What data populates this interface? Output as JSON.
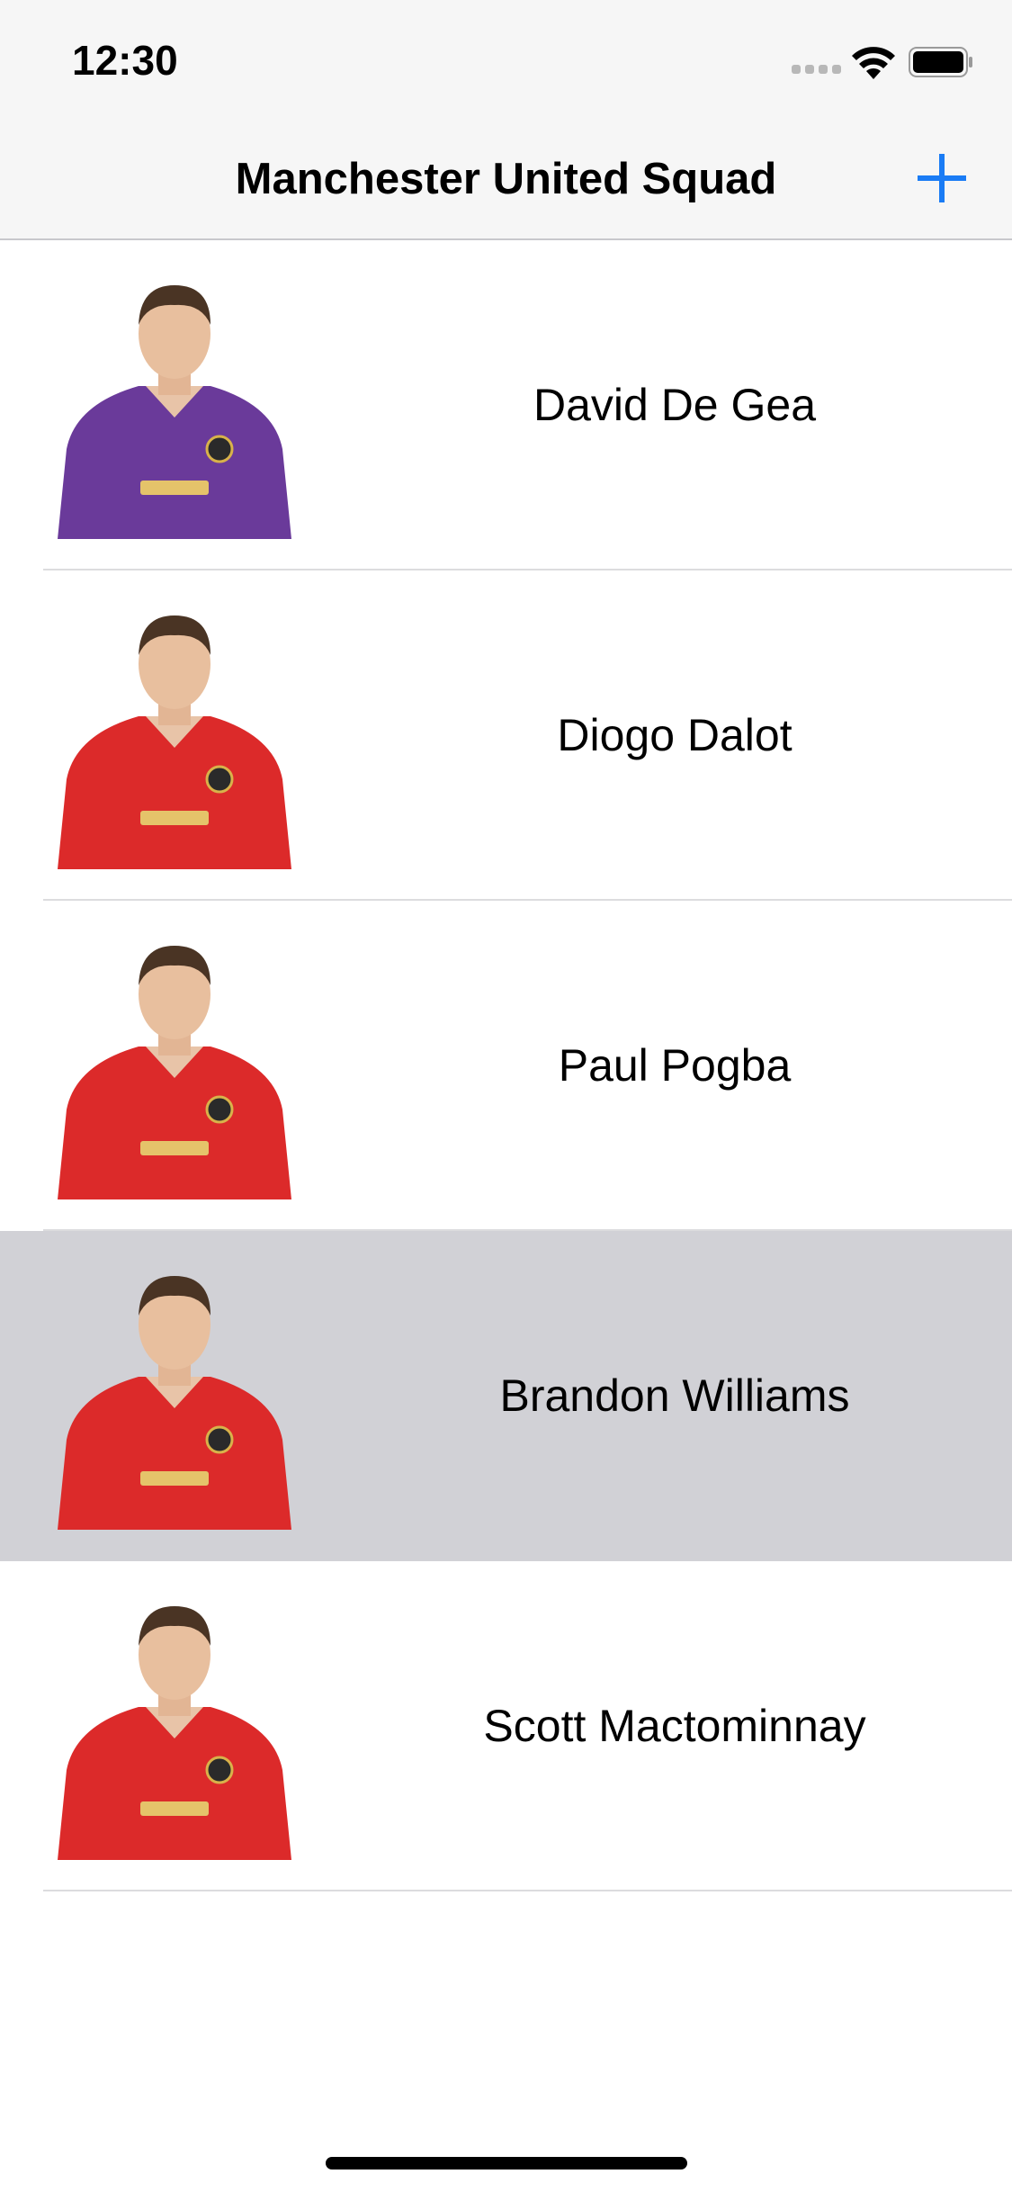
{
  "status_bar": {
    "time": "12:30",
    "signal_icon": "cellular-signal-icon",
    "wifi_icon": "wifi-icon",
    "battery_icon": "battery-icon"
  },
  "nav_bar": {
    "title": "Manchester United Squad",
    "add_icon": "plus-icon",
    "accent_color": "#1a7cf5"
  },
  "players": [
    {
      "name": "David De Gea",
      "kit_color": "#6a3a9a",
      "selected": false
    },
    {
      "name": "Diogo Dalot",
      "kit_color": "#dc2a2a",
      "selected": false
    },
    {
      "name": "Paul Pogba",
      "kit_color": "#dc2a2a",
      "selected": false
    },
    {
      "name": "Brandon Williams",
      "kit_color": "#dc2a2a",
      "selected": true
    },
    {
      "name": "Scott Mactominnay",
      "kit_color": "#dc2a2a",
      "selected": false
    }
  ],
  "colors": {
    "selected_row": "#d1d1d6",
    "bar_background": "#f6f6f6"
  }
}
